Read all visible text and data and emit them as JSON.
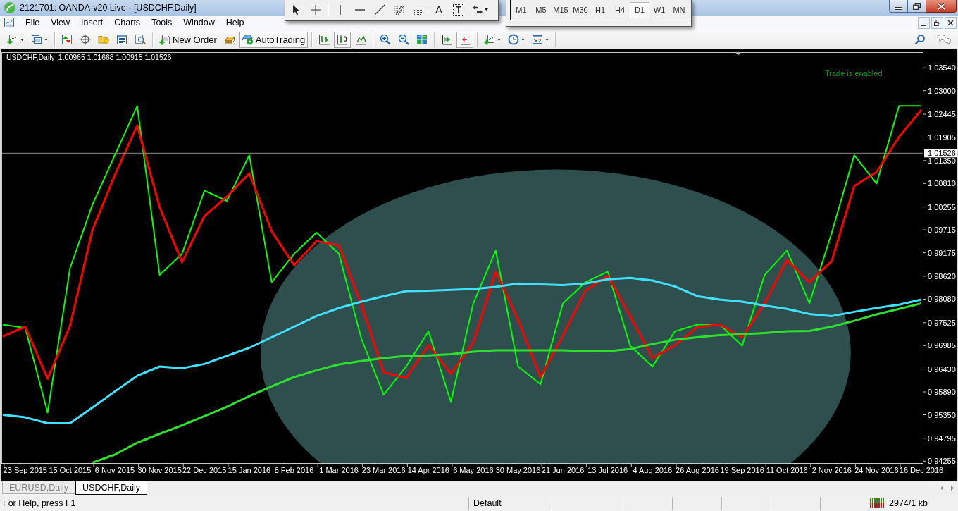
{
  "window": {
    "title": "2121701: OANDA-v20 Live - [USDCHF,Daily]"
  },
  "line_studies_toolbar": {
    "text_tool": "A",
    "label_tool": "T"
  },
  "timeframes": [
    {
      "label": "M1",
      "selected": false
    },
    {
      "label": "M5",
      "selected": false
    },
    {
      "label": "M15",
      "selected": false
    },
    {
      "label": "M30",
      "selected": false
    },
    {
      "label": "H1",
      "selected": false
    },
    {
      "label": "H4",
      "selected": false
    },
    {
      "label": "D1",
      "selected": true
    },
    {
      "label": "W1",
      "selected": false
    },
    {
      "label": "MN",
      "selected": false
    }
  ],
  "menu": [
    "File",
    "View",
    "Insert",
    "Charts",
    "Tools",
    "Window",
    "Help"
  ],
  "toolbar": {
    "new_order": "New Order",
    "autotrading": {
      "label": "AutoTrading",
      "on": true
    },
    "chart_types": [
      {
        "kind": "bars",
        "selected": false
      },
      {
        "kind": "candles",
        "selected": true
      },
      {
        "kind": "line",
        "selected": false
      }
    ],
    "chart_shift": {
      "on": false
    },
    "auto_scroll": {
      "on": true
    }
  },
  "chart": {
    "symbol": "USDCHF,Daily",
    "ohlc": "1.00965 1.01668 1.00915 1.01526",
    "trade_status": "Trade is enabled",
    "chart_data": {
      "type": "line",
      "categories": [
        null,
        "23 Sep 2015",
        null,
        "15 Oct 2015",
        null,
        "6 Nov 2015",
        null,
        "30 Nov 2015",
        null,
        "22 Dec 2015",
        null,
        "15 Jan 2016",
        null,
        "8 Feb 2016",
        null,
        "1 Mar 2016",
        null,
        "23 Mar 2016",
        null,
        "14 Apr 2016",
        null,
        "6 May 2016",
        null,
        "30 May 2016",
        null,
        "21 Jun 2016",
        null,
        "13 Jul 2016",
        null,
        "4 Aug 2016",
        null,
        "26 Aug 2016",
        null,
        "19 Sep 2016",
        null,
        "11 Oct 2016",
        null,
        "2 Nov 2016",
        null,
        "24 Nov 2016",
        null,
        "16 Dec 2016"
      ],
      "ylim": [
        0.9421,
        1.0391
      ],
      "yticks": [
        {
          "value": 1.0354,
          "label": "1.03540"
        },
        {
          "value": 1.03,
          "label": "1.03000"
        },
        {
          "value": 1.02445,
          "label": "1.02445"
        },
        {
          "value": 1.01905,
          "label": "1.01905"
        },
        {
          "value": 1.0135,
          "label": "1.01350"
        },
        {
          "value": 1.0081,
          "label": "1.00810"
        },
        {
          "value": 1.00255,
          "label": "1.00255"
        },
        {
          "value": 0.99715,
          "label": "0.99715"
        },
        {
          "value": 0.99175,
          "label": "0.99175"
        },
        {
          "value": 0.9862,
          "label": "0.98620"
        },
        {
          "value": 0.9808,
          "label": "0.98080"
        },
        {
          "value": 0.97525,
          "label": "0.97525"
        },
        {
          "value": 0.96985,
          "label": "0.96985"
        },
        {
          "value": 0.9643,
          "label": "0.96430"
        },
        {
          "value": 0.9589,
          "label": "0.95890"
        },
        {
          "value": 0.9535,
          "label": "0.95350"
        },
        {
          "value": 0.94795,
          "label": "0.94795"
        },
        {
          "value": 0.94255,
          "label": "0.94255"
        }
      ],
      "series": [
        {
          "color": "#00ff00",
          "values": [
            0.9748,
            0.974,
            0.954,
            0.9881,
            1.0031,
            1.0148,
            1.0264,
            0.9865,
            0.9915,
            1.0064,
            1.004,
            1.0148,
            0.9848,
            0.9915,
            0.9965,
            0.9915,
            0.9715,
            0.9582,
            0.9649,
            0.9732,
            0.9565,
            0.9798,
            0.9923,
            0.9649,
            0.9607,
            0.9798,
            0.9848,
            0.9873,
            0.9698,
            0.9649,
            0.9732,
            0.9748,
            0.9748,
            0.9698,
            0.9865,
            0.9923,
            0.9798,
            0.9965,
            1.0148,
            1.0081,
            1.0264,
            1.0264
          ]
        },
        {
          "color": "#ff0000",
          "values": [
            0.972,
            0.9743,
            0.962,
            0.9745,
            0.9971,
            1.0101,
            1.0218,
            1.0025,
            0.9895,
            1.0004,
            1.005,
            1.0105,
            0.9968,
            0.9888,
            0.9945,
            0.9935,
            0.9795,
            0.9635,
            0.9622,
            0.9699,
            0.9632,
            0.9705,
            0.9873,
            0.9759,
            0.9624,
            0.9722,
            0.9828,
            0.9863,
            0.9768,
            0.9669,
            0.9699,
            0.9742,
            0.9748,
            0.9718,
            0.9798,
            0.99,
            0.9848,
            0.9898,
            1.0075,
            1.0108,
            1.0191,
            1.0255
          ]
        },
        {
          "color": "#40e0ff",
          "values": [
            0.9535,
            0.9529,
            0.9515,
            0.9515,
            0.9552,
            0.959,
            0.9627,
            0.9649,
            0.9645,
            0.9655,
            0.9674,
            0.9693,
            0.9718,
            0.9743,
            0.9768,
            0.9787,
            0.9802,
            0.9815,
            0.9827,
            0.9828,
            0.983,
            0.9832,
            0.9837,
            0.9845,
            0.9843,
            0.9841,
            0.9845,
            0.9855,
            0.9858,
            0.9852,
            0.9838,
            0.9815,
            0.9807,
            0.9802,
            0.9793,
            0.9785,
            0.9773,
            0.9768,
            0.9778,
            0.9787,
            0.9795,
            0.9807
          ]
        },
        {
          "color": "#2ee02e",
          "values": [
            null,
            null,
            null,
            null,
            0.9422,
            0.9441,
            0.9469,
            0.949,
            0.951,
            0.9532,
            0.9554,
            0.9579,
            0.9602,
            0.9624,
            0.964,
            0.9654,
            0.9662,
            0.9669,
            0.9674,
            0.9675,
            0.9678,
            0.9684,
            0.9687,
            0.9687,
            0.9687,
            0.9687,
            0.9685,
            0.9685,
            0.969,
            0.9702,
            0.9712,
            0.9718,
            0.9723,
            0.9725,
            0.9728,
            0.9732,
            0.9733,
            0.9743,
            0.9757,
            0.9772,
            0.9785,
            0.9798
          ]
        }
      ],
      "ref_lines": [
        {
          "axis": "y",
          "value": 1.01526,
          "label": "1.01526"
        }
      ]
    }
  },
  "tabs": [
    {
      "label": "EURUSD,Daily",
      "selected": false
    },
    {
      "label": "USDCHF,Daily",
      "selected": true
    }
  ],
  "status_bar": {
    "help": "For Help, press F1",
    "profile": "Default",
    "traffic": "2974/1 kb"
  }
}
